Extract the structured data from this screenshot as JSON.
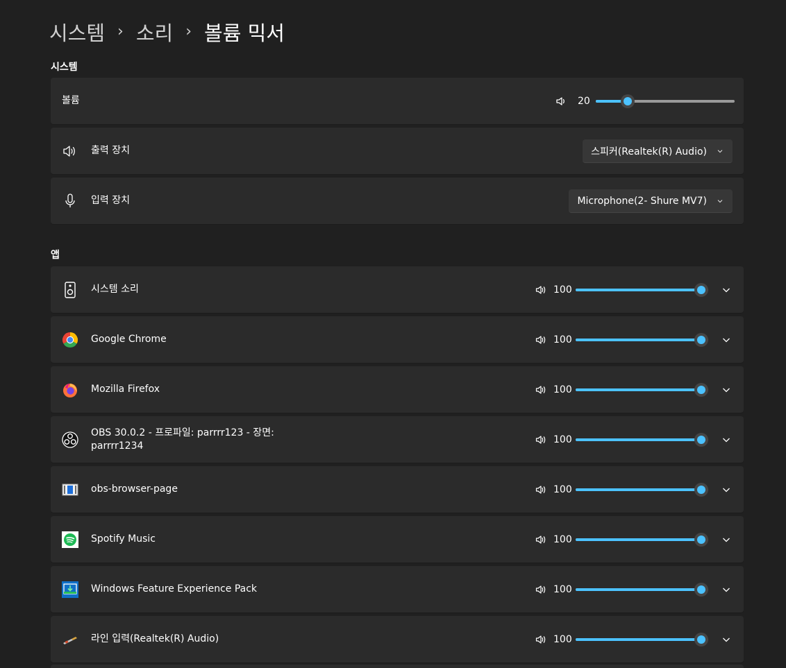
{
  "breadcrumb": {
    "items": [
      "시스템",
      "소리"
    ],
    "current": "볼륨 믹서",
    "separator": "›"
  },
  "system_section": {
    "title": "시스템",
    "volume_label": "볼륨",
    "volume_value": "20",
    "volume_level": 20,
    "output_label": "출력 장치",
    "output_device": "스피커(Realtek(R) Audio)",
    "input_label": "입력 장치",
    "input_device": "Microphone(2- Shure MV7)"
  },
  "apps_section": {
    "title": "앱",
    "apps": [
      {
        "name": "시스템 소리",
        "volume": "100",
        "level": 100,
        "icon": "system-sounds-icon"
      },
      {
        "name": "Google Chrome",
        "volume": "100",
        "level": 100,
        "icon": "chrome-icon"
      },
      {
        "name": "Mozilla Firefox",
        "volume": "100",
        "level": 100,
        "icon": "firefox-icon"
      },
      {
        "name": "OBS 30.0.2 - 프로파일: parrrr123 - 장면:",
        "name2": "parrrr1234",
        "volume": "100",
        "level": 100,
        "icon": "obs-icon"
      },
      {
        "name": "obs-browser-page",
        "volume": "100",
        "level": 100,
        "icon": "obs-browser-page-icon"
      },
      {
        "name": "Spotify Music",
        "volume": "100",
        "level": 100,
        "icon": "spotify-icon"
      },
      {
        "name": "Windows Feature Experience Pack",
        "volume": "100",
        "level": 100,
        "icon": "windows-feature-pack-icon"
      },
      {
        "name": "라인 입력(Realtek(R) Audio)",
        "volume": "100",
        "level": 100,
        "icon": "line-in-icon"
      }
    ]
  },
  "colors": {
    "accent": "#4cc2ff",
    "background": "#202020",
    "card": "#2b2b2b"
  }
}
